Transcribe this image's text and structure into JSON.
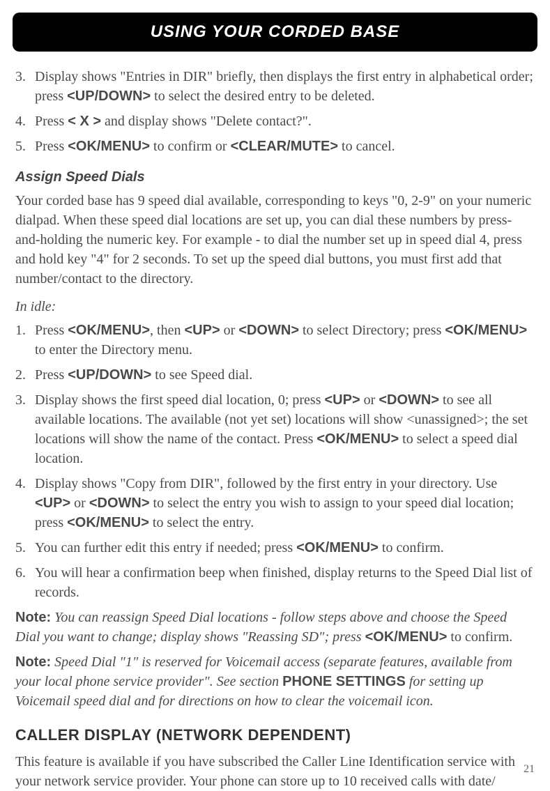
{
  "header": {
    "title": "USING YOUR CORDED BASE"
  },
  "top_list": {
    "item3_num": "3.",
    "item3_a": "Display shows \"Entries in DIR\" briefly, then displays the first entry in alphabetical order; press ",
    "item3_b": "<UP/DOWN>",
    "item3_c": " to select the desired entry to be deleted.",
    "item4_num": "4.",
    "item4_a": "Press ",
    "item4_b": "< X >",
    "item4_c": " and display shows \"Delete contact?\".",
    "item5_num": "5.",
    "item5_a": "Press ",
    "item5_b": "<OK/MENU>",
    "item5_c": " to confirm or ",
    "item5_d": "<CLEAR/MUTE>",
    "item5_e": " to cancel."
  },
  "assign": {
    "heading": "Assign Speed Dials",
    "para": "Your corded base has 9 speed dial available, corresponding to keys \"0, 2-9\" on your numeric dialpad. When these speed dial locations are set up, you can dial these numbers by press-and-holding the numeric key. For example - to dial the number set up in speed dial 4, press and hold key \"4\" for 2 seconds. To set up the speed dial buttons, you must first add that number/contact to the directory.",
    "idle_label": "In idle:",
    "s1_num": "1.",
    "s1_a": "Press ",
    "s1_b": "<OK/MENU>",
    "s1_c": ", then ",
    "s1_d": "<UP>",
    "s1_e": " or ",
    "s1_f": "<DOWN>",
    "s1_g": " to select Directory; press ",
    "s1_h": "<OK/MENU>",
    "s1_i": " to enter the Directory menu.",
    "s2_num": "2.",
    "s2_a": "Press ",
    "s2_b": "<UP/DOWN>",
    "s2_c": " to see Speed dial.",
    "s3_num": "3.",
    "s3_a": "Display shows the first speed dial location, 0; press ",
    "s3_b": "<UP>",
    "s3_c": " or ",
    "s3_d": "<DOWN>",
    "s3_e": " to see all available locations. The available (not yet set) locations will show <unassigned>; the set locations will show the name of the contact. Press ",
    "s3_f": "<OK/MENU>",
    "s3_g": " to select a speed dial location.",
    "s4_num": "4.",
    "s4_a": "Display shows \"Copy from DIR\", followed by the first entry in your directory. Use ",
    "s4_b": "<UP>",
    "s4_c": " or ",
    "s4_d": "<DOWN>",
    "s4_e": " to select the entry you wish to assign to your speed dial location; press ",
    "s4_f": "<OK/MENU>",
    "s4_g": " to select the entry.",
    "s5_num": "5.",
    "s5_a": "You can further edit this entry if needed; press ",
    "s5_b": "<OK/MENU>",
    "s5_c": " to confirm.",
    "s6_num": "6.",
    "s6_a": "You will hear a confirmation beep when finished, display returns to the Speed Dial list of records."
  },
  "notes": {
    "n1_label": "Note:",
    "n1_a": " You can reassign Speed Dial locations - follow steps above and choose the Speed Dial you want to change; display shows \"Reassing SD\"; press ",
    "n1_b": "<OK/MENU>",
    "n1_c": " to confirm.",
    "n2_label": "Note:",
    "n2_a": " Speed Dial \"1\" is reserved for Voicemail access (separate features, available from your local phone service provider\". See section ",
    "n2_b": "PHONE SETTINGS",
    "n2_c": " for setting up Voicemail speed dial and for directions on how to clear the voicemail icon."
  },
  "caller": {
    "heading": "CALLER DISPLAY (NETWORK DEPENDENT)",
    "para": "This feature is available if you have subscribed the Caller Line Identification service with your network service provider. Your phone can store up to 10 received calls with date/"
  },
  "page_number": "21"
}
